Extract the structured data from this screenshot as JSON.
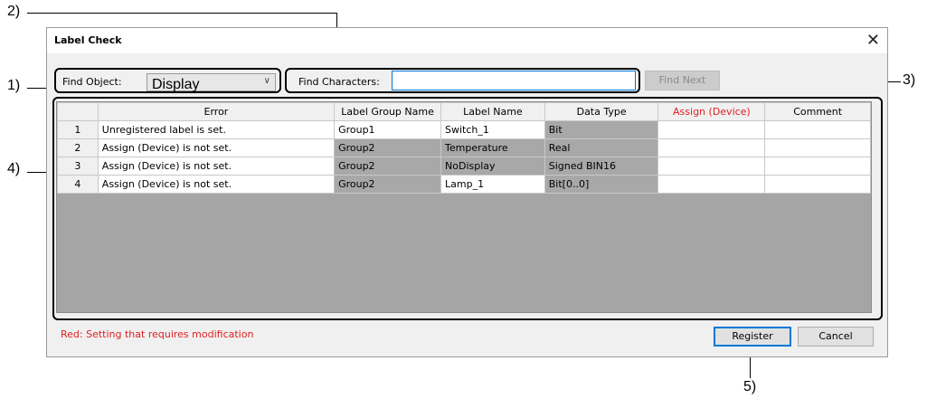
{
  "callouts": {
    "c1": "1)",
    "c2": "2)",
    "c3": "3)",
    "c4": "4)",
    "c5": "5)"
  },
  "dialog": {
    "title": "Label Check",
    "close": "✕",
    "find_object_label": "Find Object:",
    "find_object_value": "Display",
    "find_characters_label": "Find Characters:",
    "find_characters_value": "",
    "find_next_label": "Find Next",
    "note": "Red: Setting that requires modification",
    "register_label": "Register",
    "cancel_label": "Cancel"
  },
  "table": {
    "headers": [
      "",
      "Error",
      "Label Group Name",
      "Label Name",
      "Data Type",
      "Assign (Device)",
      "Comment"
    ],
    "rows": [
      {
        "n": "1",
        "error": "Unregistered label is set.",
        "group": "Group1",
        "label": "Switch_1",
        "type": "Bit",
        "assign": "",
        "comment": ""
      },
      {
        "n": "2",
        "error": "Assign (Device) is not set.",
        "group": "Group2",
        "label": "Temperature",
        "type": "Real",
        "assign": "",
        "comment": ""
      },
      {
        "n": "3",
        "error": "Assign (Device) is not set.",
        "group": "Group2",
        "label": "NoDisplay",
        "type": "Signed BIN16",
        "assign": "",
        "comment": ""
      },
      {
        "n": "4",
        "error": "Assign (Device) is not set.",
        "group": "Group2",
        "label": "Lamp_1",
        "type": "Bit[0..0]",
        "assign": "",
        "comment": ""
      }
    ]
  },
  "colors": {
    "required_text": "#e02020",
    "focus_border": "#0078d7"
  }
}
